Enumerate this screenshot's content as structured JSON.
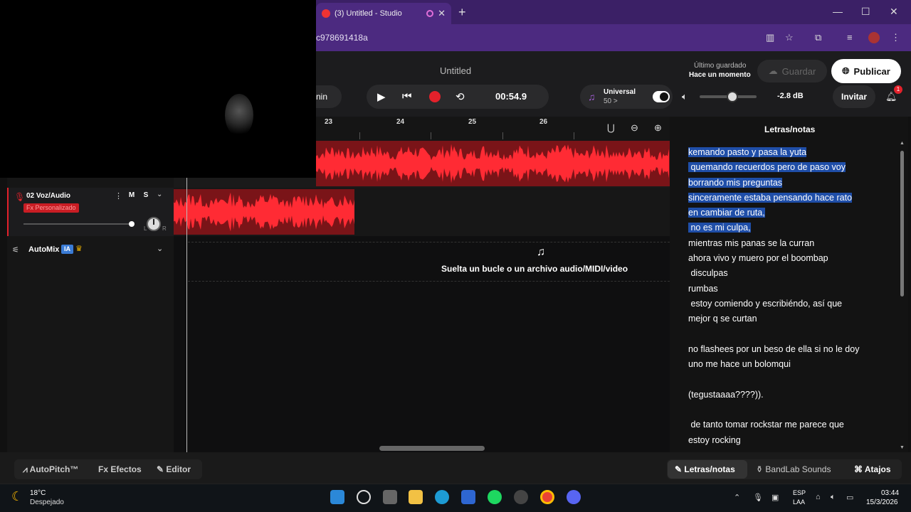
{
  "browser": {
    "tab_title": "(3) Untitled - Studio",
    "url": "c978691418a",
    "new_tab": "+",
    "close_tab": "✕",
    "minimize": "—",
    "maximize": "☐",
    "close": "✕"
  },
  "header": {
    "title": "Untitled",
    "last_saved_label": "Último guardado",
    "last_saved_value": "Hace un momento",
    "save_label": "Guardar",
    "publish_label": "Publicar",
    "mode_partial": "nin",
    "time": "00:54.9",
    "key_name": "Universal",
    "bpm": "50 >",
    "volume_db": "-2.8 dB",
    "volume_level": 0.55,
    "invite_label": "Invitar",
    "notification_count": "1"
  },
  "tracks": {
    "track2": {
      "name": "02  Voz/Audio",
      "fx": "Fx Personalizado",
      "mute": "M",
      "solo": "S",
      "left": "L",
      "right": "R"
    },
    "automix": {
      "label": "AutoMix",
      "badge": "IA"
    }
  },
  "timeline": {
    "ruler": [
      "23",
      "24",
      "25",
      "26"
    ],
    "drop_text": "Suelta un bucle o un archivo audio/MIDI/video"
  },
  "lyrics": {
    "title": "Letras/notas",
    "lines": [
      "kemando pasto y pasa la yuta",
      " quemando recuerdos pero de paso voy",
      "borrando mis preguntas",
      "sinceramente estaba pensando hace rato",
      "en cambiar de ruta,",
      " no es mi culpa,",
      "mientras mis panas se la curran",
      "ahora vivo y muero por el boombap",
      " disculpas",
      "rumbas",
      " estoy comiendo y escribiéndo, así que",
      "mejor q se curtan",
      "",
      "no flashees por un beso de ella si no le doy",
      "uno me hace un bolomqui",
      "",
      "(tegustaaaa????)).",
      "",
      " de tanto tomar rockstar me parece que",
      "estoy rocking"
    ]
  },
  "bottom": {
    "autopitch": "AutoPitch™",
    "effects": "Efectos",
    "editor": "Editor",
    "lyrics": "Letras/notas",
    "sounds": "BandLab Sounds",
    "shortcuts": "Atajos"
  },
  "taskbar": {
    "temp": "18°C",
    "condition": "Despejado",
    "lang1": "ESP",
    "lang2": "LAA",
    "time": "03:44",
    "date": "15/3/2026"
  },
  "colors": {
    "accent_red": "#e4212b",
    "selection": "#1f4ea8",
    "browser_purple": "#4c2a80"
  }
}
